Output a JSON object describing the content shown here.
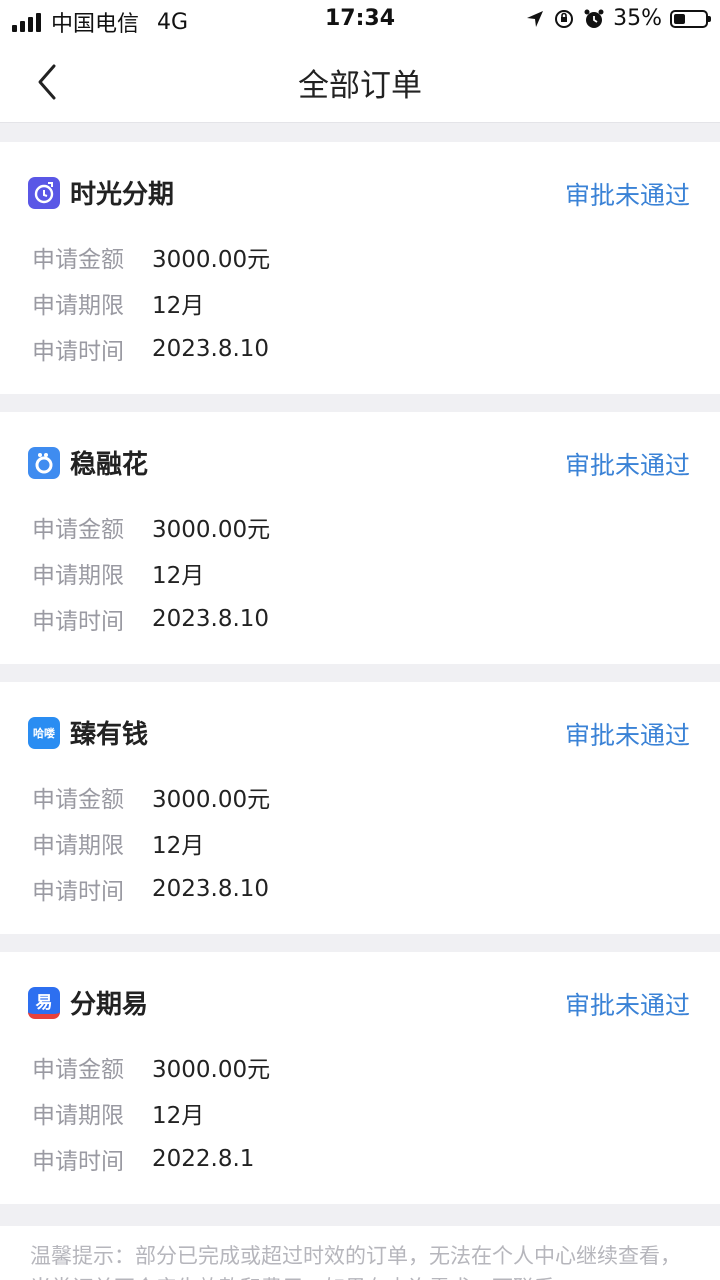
{
  "status_bar": {
    "carrier": "中国电信",
    "network": "4G",
    "time": "17:34",
    "battery": "35%",
    "battery_level": 0.35
  },
  "nav": {
    "title": "全部订单",
    "back_icon": "chevron-left-icon"
  },
  "labels": {
    "amount": "申请金额",
    "term": "申请期限",
    "time": "申请时间"
  },
  "orders": [
    {
      "app": "时光分期",
      "status": "审批未通过",
      "amount": "3000.00元",
      "term": "12月",
      "date": "2023.8.10",
      "icon_color": "#5a57e6"
    },
    {
      "app": "稳融花",
      "status": "审批未通过",
      "amount": "3000.00元",
      "term": "12月",
      "date": "2023.8.10",
      "icon_color": "#3f8cf0"
    },
    {
      "app": "臻有钱",
      "status": "审批未通过",
      "amount": "3000.00元",
      "term": "12月",
      "date": "2023.8.10",
      "icon_color": "#2a8df2",
      "icon_text": "哈喽"
    },
    {
      "app": "分期易",
      "status": "审批未通过",
      "amount": "3000.00元",
      "term": "12月",
      "date": "2022.8.1",
      "icon_color": "#2d6ff0",
      "icon_text": "易"
    }
  ],
  "tip": {
    "text": "温馨提示：部分已完成或超过时效的订单，无法在个人中心继续查看，当常订单不会产生放款和费用，如果有查询需求，可联系"
  },
  "colors": {
    "accent": "#3a82d6",
    "label": "#9a9aa2"
  }
}
